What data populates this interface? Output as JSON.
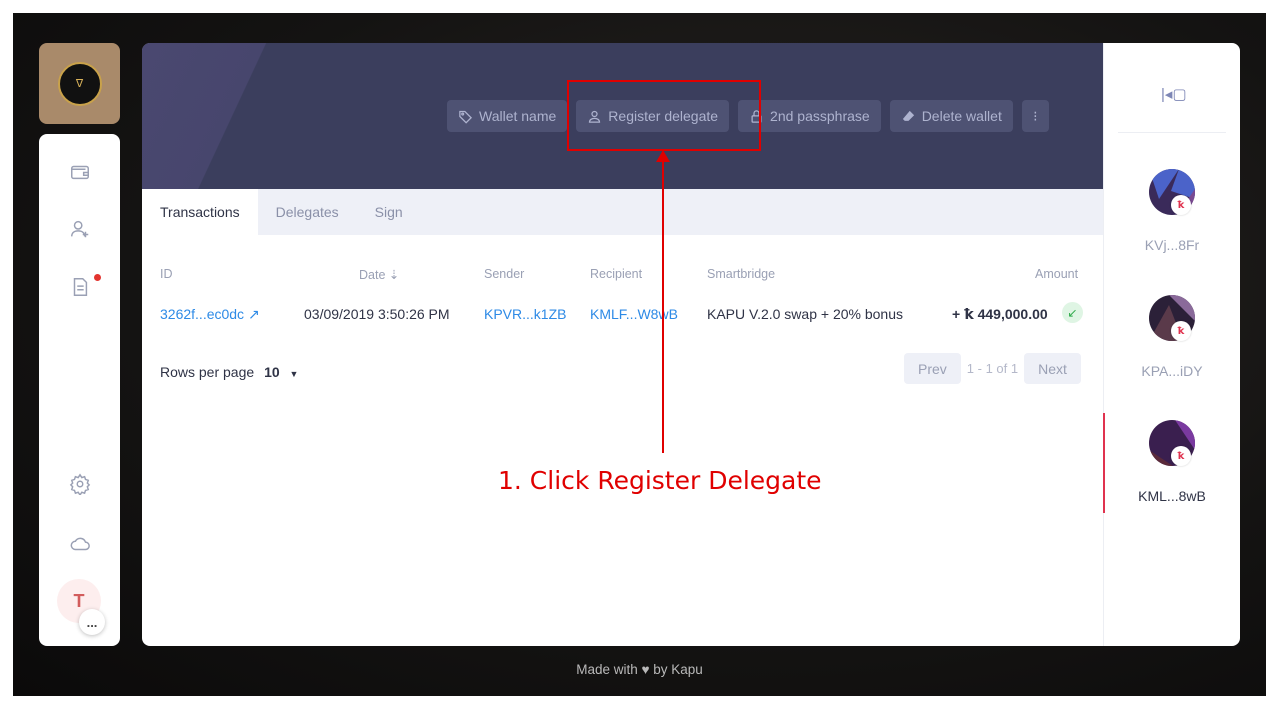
{
  "sidebar": {
    "logo_text": "ᐁ",
    "user_initial": "T",
    "more_label": "..."
  },
  "header": {
    "actions": [
      {
        "label": "Wallet name"
      },
      {
        "label": "Register delegate"
      },
      {
        "label": "2nd passphrase"
      },
      {
        "label": "Delete wallet"
      }
    ],
    "more_icon": "⁝"
  },
  "tabs": [
    {
      "label": "Transactions"
    },
    {
      "label": "Delegates"
    },
    {
      "label": "Sign"
    }
  ],
  "table": {
    "columns": {
      "id": "ID",
      "date": "Date",
      "sender": "Sender",
      "recipient": "Recipient",
      "smartbridge": "Smartbridge",
      "amount": "Amount"
    },
    "rows": [
      {
        "id": "3262f...ec0dc",
        "date": "03/09/2019 3:50:26 PM",
        "sender": "KPVR...k1ZB",
        "recipient": "KMLF...W8wB",
        "smartbridge": "KAPU V.2.0 swap + 20% bonus",
        "amount": "+ ꝁ 449,000.00"
      }
    ]
  },
  "pagination": {
    "rows_label": "Rows per page",
    "rows_value": "10",
    "prev": "Prev",
    "info": "1 - 1 of 1",
    "next": "Next"
  },
  "wallets": [
    {
      "name": "KVj...8Fr",
      "active": false,
      "colors": [
        "#3a2a5a",
        "#4b63c9",
        "#7a4a92"
      ]
    },
    {
      "name": "KPA...iDY",
      "active": false,
      "colors": [
        "#2b2038",
        "#8a6a9a",
        "#5a3a4a"
      ]
    },
    {
      "name": "KML...8wB",
      "active": true,
      "colors": [
        "#3a1f4f",
        "#7a3aa0",
        "#5a2a3a"
      ]
    }
  ],
  "footer": "Made with ♥ by Kapu",
  "annotation": {
    "text": "1. Click Register Delegate",
    "color": "#e00000"
  }
}
